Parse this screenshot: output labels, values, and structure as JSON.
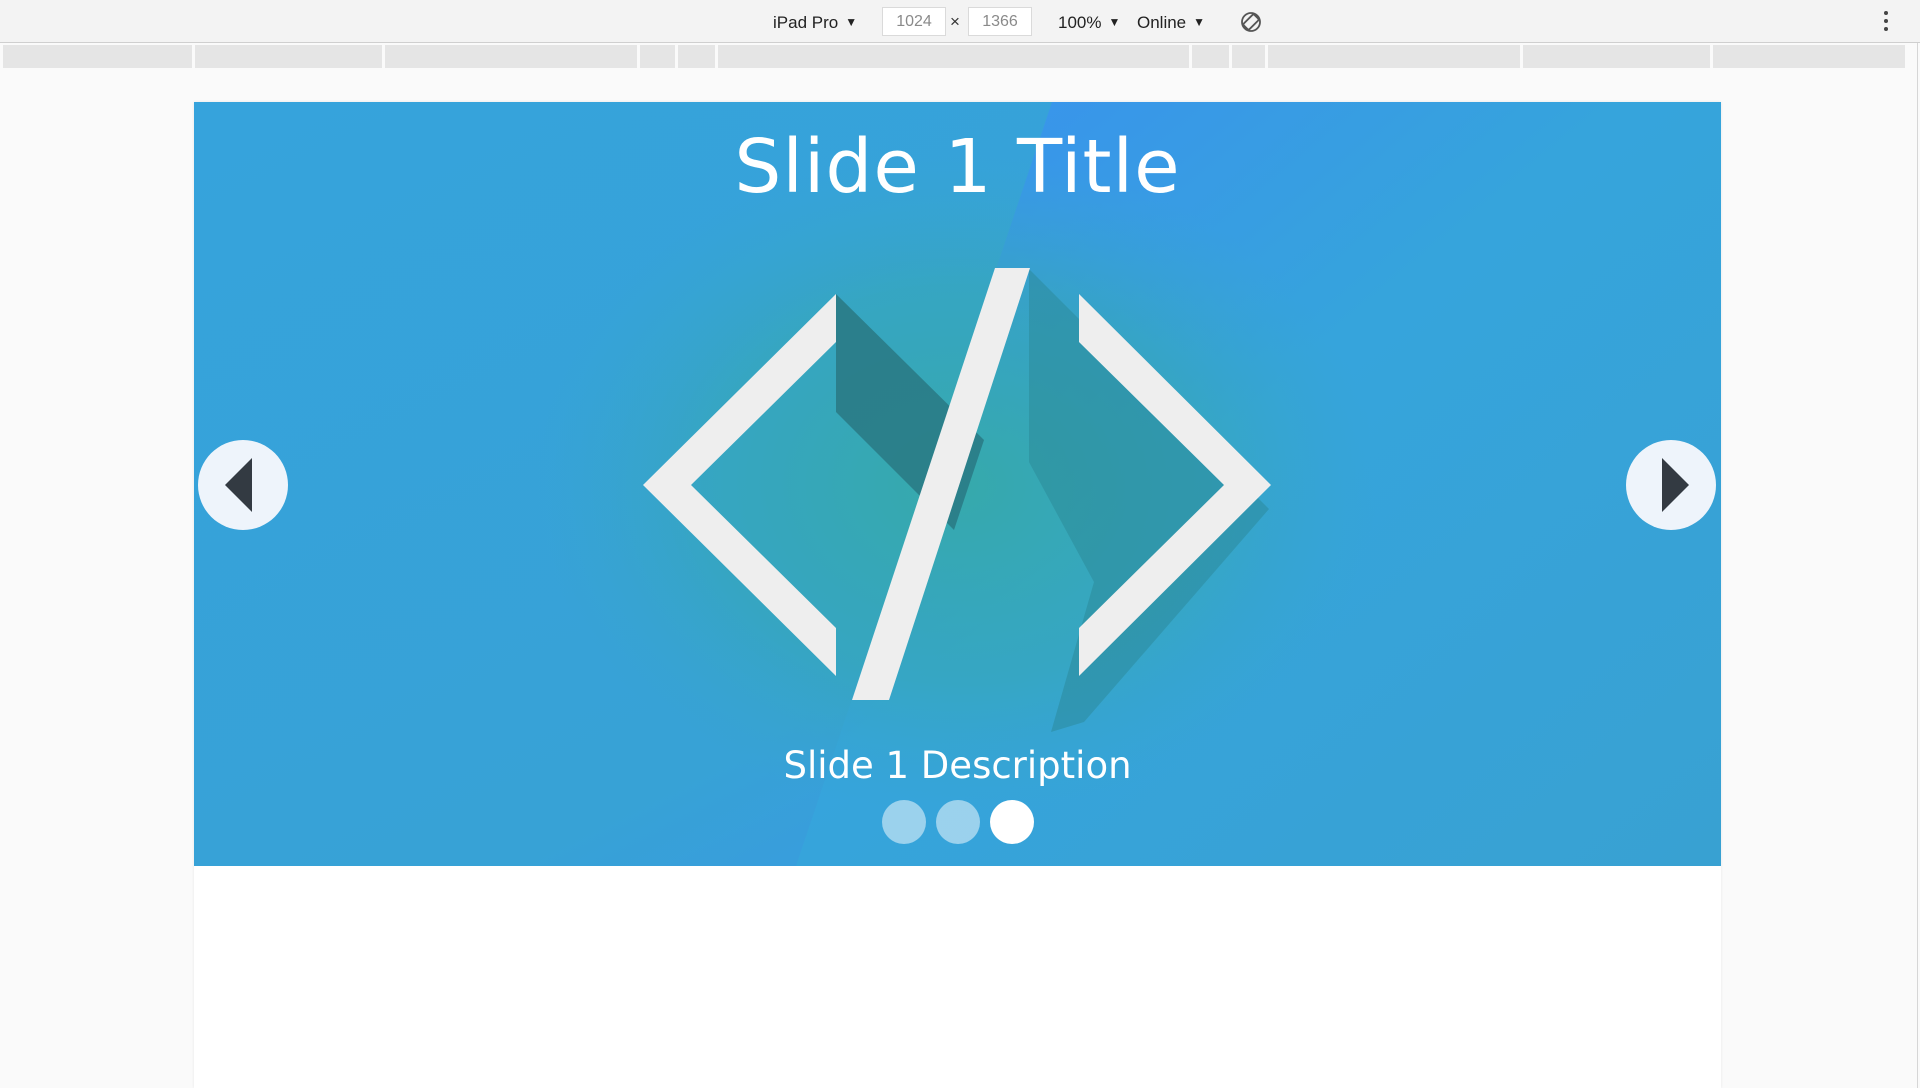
{
  "toolbar": {
    "device": "iPad Pro",
    "width_value": "1024",
    "height_value": "1366",
    "times_symbol": "×",
    "zoom": "100%",
    "network": "Online",
    "rotate_icon": "rotate-icon",
    "more_icon": "kebab-menu-icon"
  },
  "carousel": {
    "title": "Slide 1 Title",
    "description": "Slide 1 Description",
    "image_icon": "code-brackets-icon",
    "prev_icon": "arrow-left-icon",
    "next_icon": "arrow-right-icon",
    "slide_count": 3,
    "active_index": 2,
    "colors": {
      "blue_light": "#35a6dd",
      "blue_bright": "#3890ee",
      "teal": "#35a8b0",
      "glyph": "#eeeeee"
    }
  }
}
